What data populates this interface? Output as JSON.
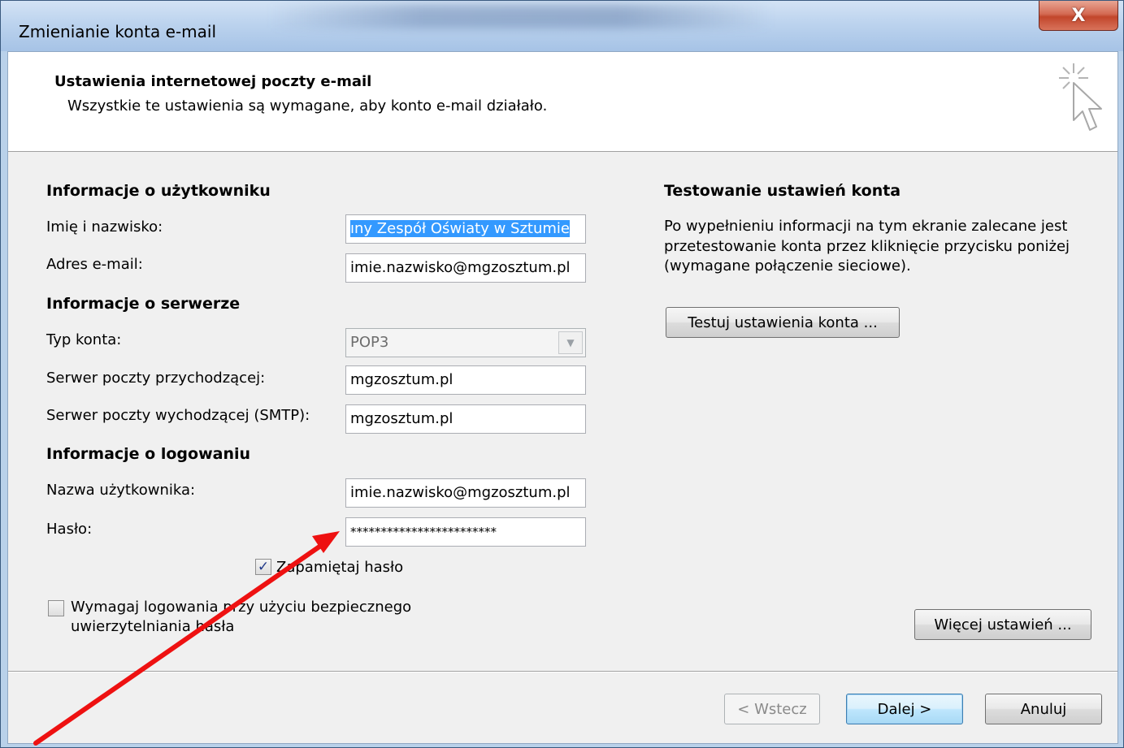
{
  "window": {
    "title": "Zmienianie konta e-mail",
    "close_label": "X"
  },
  "header": {
    "title": "Ustawienia internetowej poczty e-mail",
    "subtitle": "Wszystkie te ustawienia są wymagane, aby konto e-mail działało.",
    "icon": "cursor-sparkle-icon"
  },
  "user_info": {
    "heading": "Informacje o użytkowniku",
    "name_label": "Imię i nazwisko:",
    "name_value": "ıny Zespół Oświaty w Sztumie",
    "email_label": "Adres e-mail:",
    "email_value": "imie.nazwisko@mgzosztum.pl"
  },
  "server_info": {
    "heading": "Informacje o serwerze",
    "type_label": "Typ konta:",
    "type_value": "POP3",
    "incoming_label": "Serwer poczty przychodzącej:",
    "incoming_value": "mgzosztum.pl",
    "outgoing_label": "Serwer poczty wychodzącej (SMTP):",
    "outgoing_value": "mgzosztum.pl"
  },
  "login_info": {
    "heading": "Informacje o logowaniu",
    "username_label": "Nazwa użytkownika:",
    "username_value": "imie.nazwisko@mgzosztum.pl",
    "password_label": "Hasło:",
    "password_value": "************************",
    "remember_label": "Zapamiętaj hasło",
    "remember_checked": true,
    "spa_label_line1": "Wymagaj logowania przy użyciu bezpiecznego",
    "spa_label_line2": "uwierzytelniania hasła",
    "spa_checked": false
  },
  "test_panel": {
    "heading": "Testowanie ustawień konta",
    "desc_line1": "Po wypełnieniu informacji na tym ekranie zalecane jest",
    "desc_line2": "przetestowanie konta przez kliknięcie przycisku poniżej",
    "desc_line3": "(wymagane połączenie sieciowe).",
    "test_button": "Testuj ustawienia konta ..."
  },
  "buttons": {
    "more_settings": "Więcej ustawień ...",
    "back": "< Wstecz",
    "next": "Dalej >",
    "cancel": "Anuluj"
  },
  "annotation": {
    "arrow_color": "#ee1111"
  }
}
